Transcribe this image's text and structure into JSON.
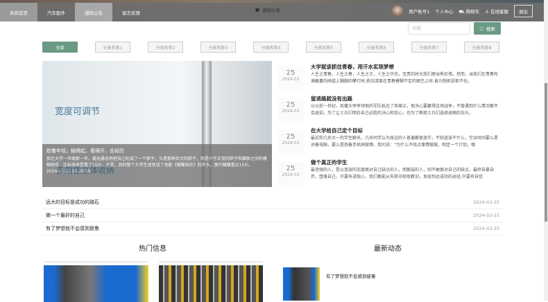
{
  "nav": {
    "items": [
      "系统首页",
      "汽车配件",
      "通知公告",
      "留言反馈"
    ],
    "notice": "通知公告"
  },
  "user": {
    "account": "用户账号1",
    "center": "个人中心",
    "cart": "购物车",
    "service": "在线客服",
    "logout": "退出"
  },
  "search": {
    "placeholder": "标题",
    "button": "搜索"
  },
  "categories": [
    "全部",
    "分类名称1",
    "分类名称2",
    "分类名称3",
    "分类名称4",
    "分类名称5",
    "分类名称6",
    "分类名称7",
    "分类名称8"
  ],
  "carousel": {
    "image_text1": "宽度可调节",
    "image_text2": "多用途立体收纳",
    "title": "趁着年轻，输得起，看得开，去经历",
    "desc": "我在大学一年级那一年，毫无悬念地把自己吃成了一个胖子，头是那种巨大的胖子，而是介于正常的胖子和臃肿之间的模糊地带，比标准体型重了15斤。于是，我的整个大学生涯变成了电影《蝴蝶效应》的开头，那只蝴蝶重达15斤。",
    "time": "2024-03-25 10:22:15"
  },
  "news": [
    {
      "day": "25",
      "month": "2024-03",
      "title": "大学就该抓住青春，用汗水实现梦想",
      "desc": "人生之青春，人生之春，人生之王，人生之华也，宝贵的时光我们理当秀珍惜。然而，当我们在青春布满藤蔓的闸道上蹒跚的攀行时;依旧游离在青春模糊不定的尾巴上时;奋力想抓却抓不住。"
    },
    {
      "day": "25",
      "month": "2024-03",
      "title": "留退路就没有出路",
      "desc": "公元前一世纪，凯撒大帝率领他的军队抵达了英格兰，他决心要赢得这场战争，不管遇到什么情况都不会退却。为了让士兵们明白自己必胜的决心和信心，也为了断绝士兵们选择退缩的念头。"
    },
    {
      "day": "25",
      "month": "2024-03",
      "title": "在大学给自己定个目标",
      "desc": "最近和几名大一的学生聊天，几名同学认为身边的人普遍都很迷茫，不知道该干什么，空余时间要么是对着电脑，要么是抱着手机刷微博。我问说：“为什么不找点事情做做，制定一个计划，哪"
    },
    {
      "day": "25",
      "month": "2024-03",
      "title": "做个真正的学生",
      "desc": "最坚强的人，是以宽容的态度面对自己缺点的人，而脆弱的人，则不敢面对自己的缺点，最终自暴自弃，堕落自己。只要有进取心，我们都能从失败中吸取教训，发现到达成功的途径;只要有自信"
    }
  ],
  "list": [
    {
      "title": "远大的目标是成功的磁石",
      "date": "2024-03-25"
    },
    {
      "title": "做一个最好的自己",
      "date": "2024-03-25"
    },
    {
      "title": "有了梦想就不会感到疲惫",
      "date": "2024-03-25"
    }
  ],
  "sections": {
    "hot": "热门信息",
    "latest": "最新动态",
    "latest_item": "有了梦想就不会感到疲惫"
  }
}
